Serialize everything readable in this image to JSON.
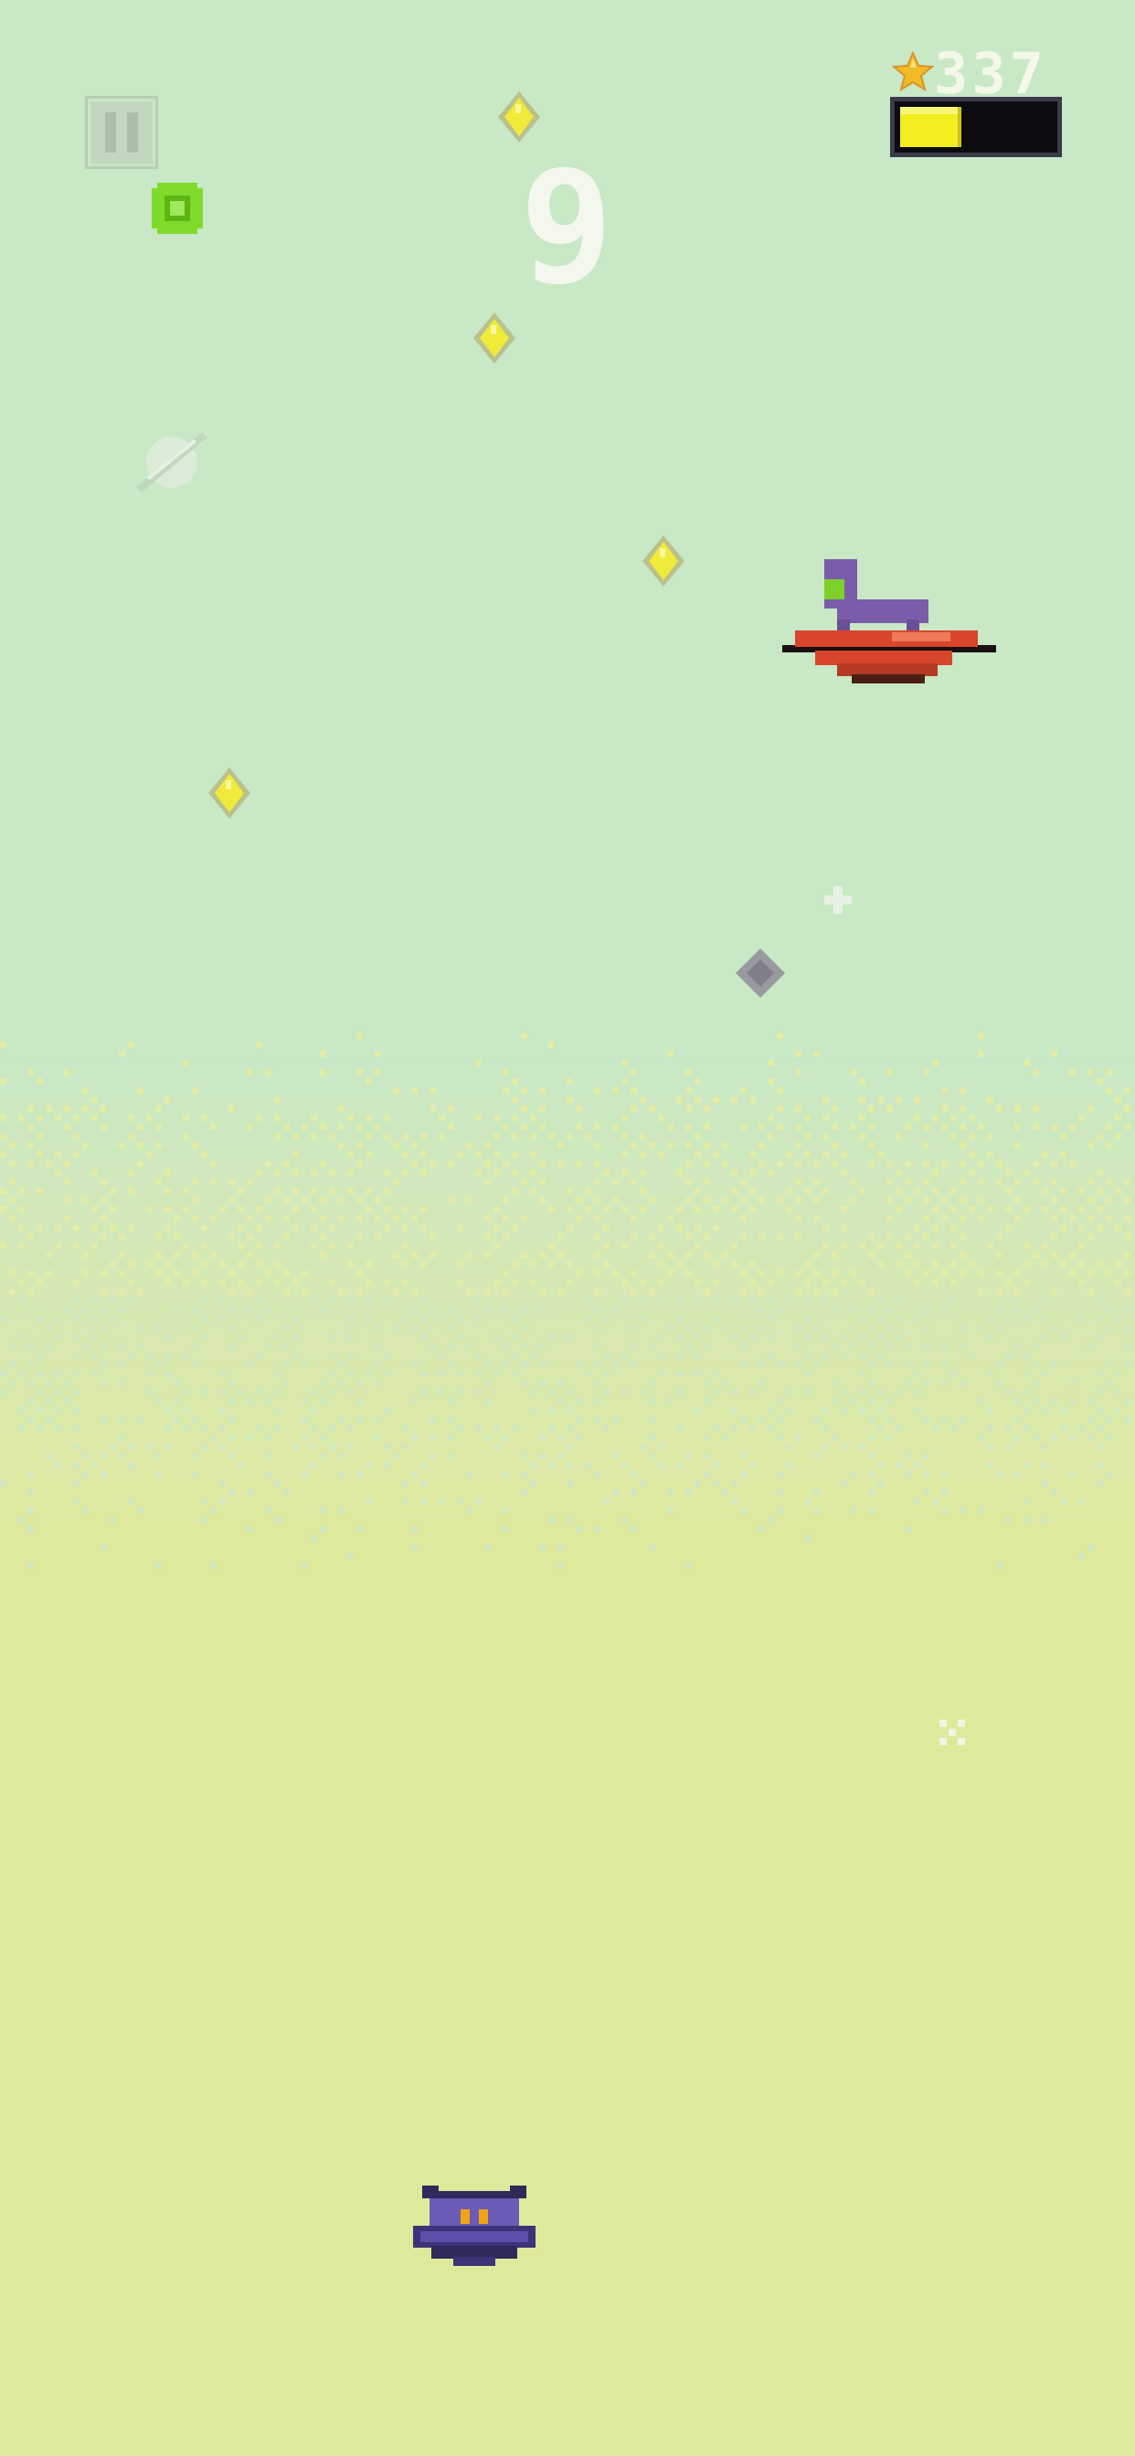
{
  "hud": {
    "score": "337",
    "wave": "9",
    "energy_fraction": 0.38,
    "score_icon": "star-icon",
    "pause_icon": "pause-icon"
  },
  "colors": {
    "sky": "#c8e8c6",
    "ground": "#dfe99c",
    "energy_fill": "#f2ee20",
    "player": "#6b5bb5",
    "enemy_sled": "#d8452a",
    "enemy_rider": "#7a5ca8",
    "coin": "#f0ea3a",
    "powerup": "#6ed31a"
  },
  "sprites": {
    "player": "purple-ship-player",
    "enemy": "purple-rider-on-red-sled",
    "pickups": [
      "yellow-gem-coin",
      "green-powerup",
      "gray-rock",
      "faded-planet"
    ]
  }
}
